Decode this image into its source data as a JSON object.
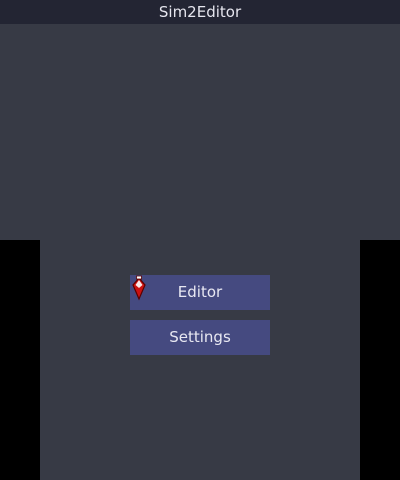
{
  "app": {
    "title": "Sim2Editor"
  },
  "menu": {
    "items": [
      {
        "label": "Editor"
      },
      {
        "label": "Settings"
      }
    ]
  },
  "cursor": {
    "icon": "red-diamond-pointer-icon"
  },
  "colors": {
    "background": "#373a45",
    "title_bar": "#232533",
    "button": "#454a80",
    "outer_frame": "#000000",
    "cursor": "#cc1111"
  }
}
